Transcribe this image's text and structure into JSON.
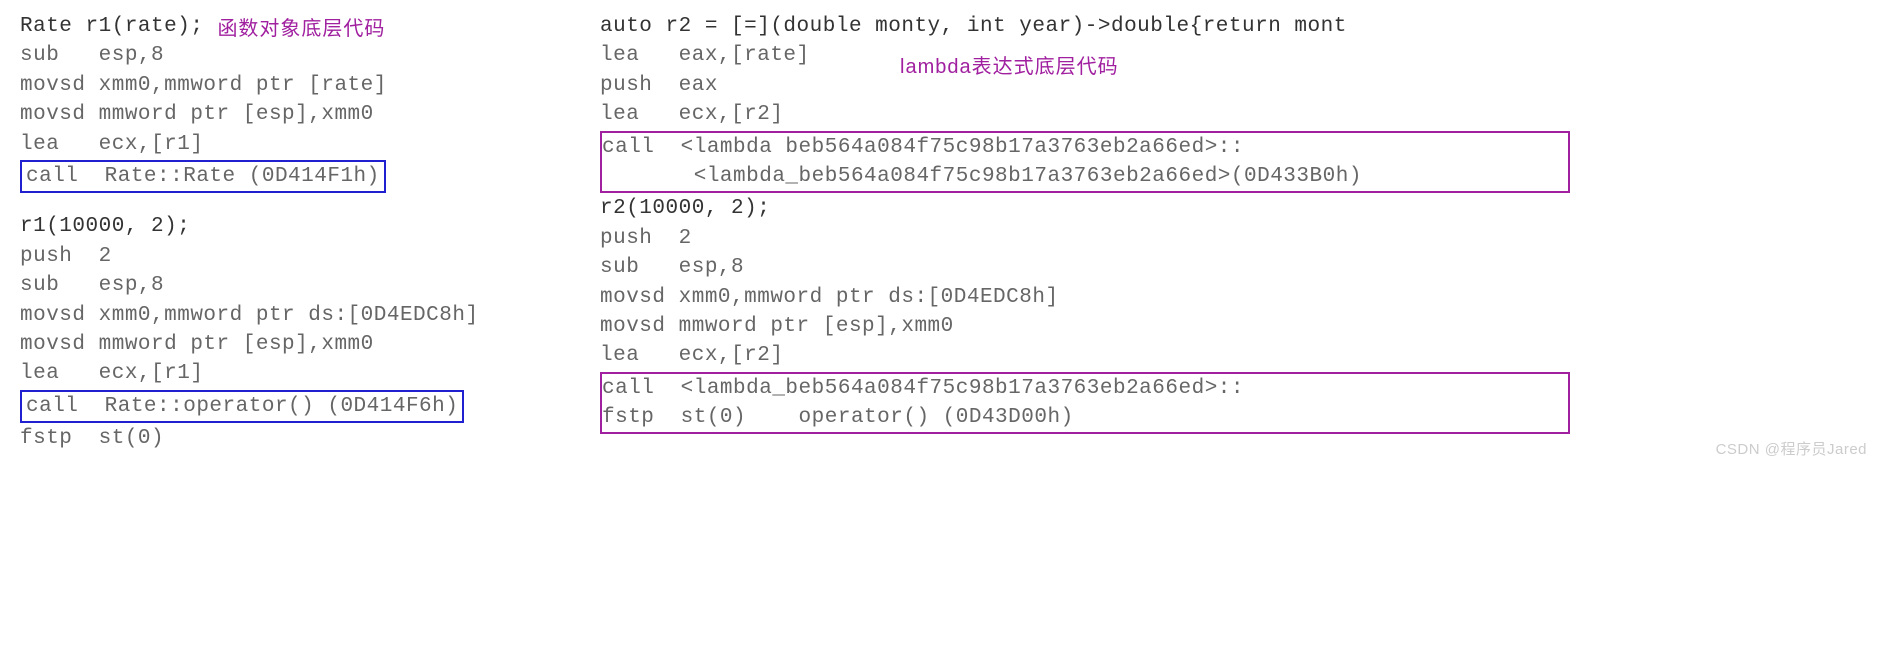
{
  "left": {
    "note": "函数对象底层代码",
    "src1": "Rate r1(rate);",
    "asm1": [
      "sub   esp,8",
      "movsd xmm0,mmword ptr [rate]",
      "movsd mmword ptr [esp],xmm0",
      "lea   ecx,[r1]"
    ],
    "call1": "call  Rate::Rate (0D414F1h)",
    "src2": "r1(10000, 2);",
    "asm2": [
      "push  2",
      "sub   esp,8",
      "movsd xmm0,mmword ptr ds:[0D4EDC8h]",
      "movsd mmword ptr [esp],xmm0",
      "lea   ecx,[r1]"
    ],
    "call2": "call  Rate::operator() (0D414F6h)",
    "tail": "fstp  st(0)"
  },
  "right": {
    "note": "lambda表达式底层代码",
    "src1": "auto r2 = [=](double monty, int year)->double{return mont",
    "asm1": [
      "lea   eax,[rate]",
      "push  eax",
      "lea   ecx,[r2]"
    ],
    "call1a": "call  <lambda beb564a084f75c98b17a3763eb2a66ed>::",
    "call1b": "       <lambda_beb564a084f75c98b17a3763eb2a66ed>(0D433B0h)",
    "src2": "r2(10000, 2);",
    "asm2": [
      "push  2",
      "sub   esp,8",
      "movsd xmm0,mmword ptr ds:[0D4EDC8h]",
      "movsd mmword ptr [esp],xmm0",
      "lea   ecx,[r2]"
    ],
    "call2a": "call  <lambda_beb564a084f75c98b17a3763eb2a66ed>::",
    "call2b": "fstp  st(0)    operator() (0D43D00h)"
  },
  "watermark": "CSDN @程序员Jared"
}
